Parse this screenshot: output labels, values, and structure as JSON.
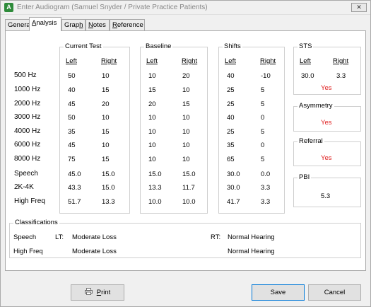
{
  "window": {
    "title": "Enter Audiogram (Samuel Snyder / Private Practice Patients)",
    "close_label": "✕"
  },
  "tabs": [
    {
      "label": "General",
      "underline": "",
      "rest": ""
    },
    {
      "label": "Analysis",
      "underline": "A",
      "rest": "nalysis"
    },
    {
      "label": "Graph",
      "underline": "h",
      "pre": "Grap"
    },
    {
      "label": "Notes",
      "underline": "N",
      "rest": "otes"
    },
    {
      "label": "Reference",
      "underline": "R",
      "rest": "eference"
    }
  ],
  "row_labels": [
    "500 Hz",
    "1000 Hz",
    "2000 Hz",
    "3000 Hz",
    "4000 Hz",
    "6000 Hz",
    "8000 Hz",
    "Speech",
    "2K-4K",
    "High Freq"
  ],
  "current_test": {
    "title": "Current Test",
    "left_header": "Left",
    "right_header": "Right",
    "left": [
      "50",
      "40",
      "45",
      "50",
      "35",
      "45",
      "75",
      "45.0",
      "43.3",
      "51.7"
    ],
    "right": [
      "10",
      "15",
      "20",
      "10",
      "15",
      "10",
      "15",
      "15.0",
      "15.0",
      "13.3"
    ]
  },
  "baseline": {
    "title": "Baseline",
    "left_header": "Left",
    "right_header": "Right",
    "left": [
      "10",
      "15",
      "20",
      "10",
      "10",
      "10",
      "10",
      "15.0",
      "13.3",
      "10.0"
    ],
    "right": [
      "20",
      "10",
      "15",
      "10",
      "10",
      "10",
      "10",
      "15.0",
      "11.7",
      "10.0"
    ]
  },
  "shifts": {
    "title": "Shifts",
    "left_header": "Left",
    "right_header": "Right",
    "left": [
      "40",
      "25",
      "25",
      "40",
      "25",
      "35",
      "65",
      "30.0",
      "30.0",
      "41.7"
    ],
    "right": [
      "-10",
      "5",
      "5",
      "0",
      "5",
      "0",
      "5",
      "0.0",
      "3.3",
      "3.3"
    ]
  },
  "sts": {
    "title": "STS",
    "left_header": "Left",
    "right_header": "Right",
    "left_value": "30.0",
    "right_value": "3.3",
    "result": "Yes"
  },
  "asymmetry": {
    "title": "Asymmetry",
    "result": "Yes"
  },
  "referral": {
    "title": "Referral",
    "result": "Yes"
  },
  "pbi": {
    "title": "PBI",
    "value": "5.3"
  },
  "classifications": {
    "title": "Classifications",
    "rows": [
      {
        "label": "Speech",
        "lt_label": "LT:",
        "left": "Moderate Loss",
        "rt_label": "RT:",
        "right": "Normal Hearing"
      },
      {
        "label": "High Freq",
        "lt_label": "",
        "left": "Moderate Loss",
        "rt_label": "",
        "right": "Normal Hearing"
      }
    ]
  },
  "buttons": {
    "print_rest": "rint",
    "print_underline": "P",
    "save": "Save",
    "cancel": "Cancel"
  },
  "colors": {
    "result_red": "#e02020",
    "app_icon": "#2e8b3a"
  }
}
